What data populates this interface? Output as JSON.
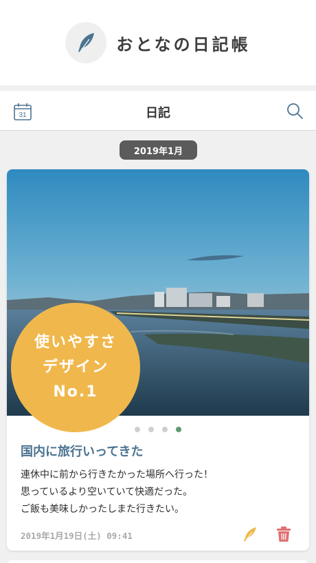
{
  "app": {
    "title": "おとなの日記帳",
    "logo_icon": "feather-icon"
  },
  "toolbar": {
    "title": "日記",
    "calendar_day": "31",
    "left_icon": "calendar-icon",
    "right_icon": "search-icon"
  },
  "month_label": "2019年1月",
  "entry": {
    "badge_lines": [
      "使いやすさ",
      "デザイン",
      "No.1"
    ],
    "title": "国内に旅行いってきた",
    "body_lines": [
      "連休中に前から行きたかった場所へ行った！",
      "思っているより空いていて快適だった。",
      "ご飯も美味しかったしまた行きたい。"
    ],
    "date": "2019年1月19日(土) 09:41",
    "carousel": {
      "count": 4,
      "active_index": 3
    },
    "edit_icon": "feather-icon",
    "delete_icon": "trash-icon"
  },
  "colors": {
    "accent": "#4b7390",
    "badge": "#f0b84c",
    "active_dot": "#5d9a73",
    "delete": "#e07070",
    "edit": "#f0b84c"
  }
}
